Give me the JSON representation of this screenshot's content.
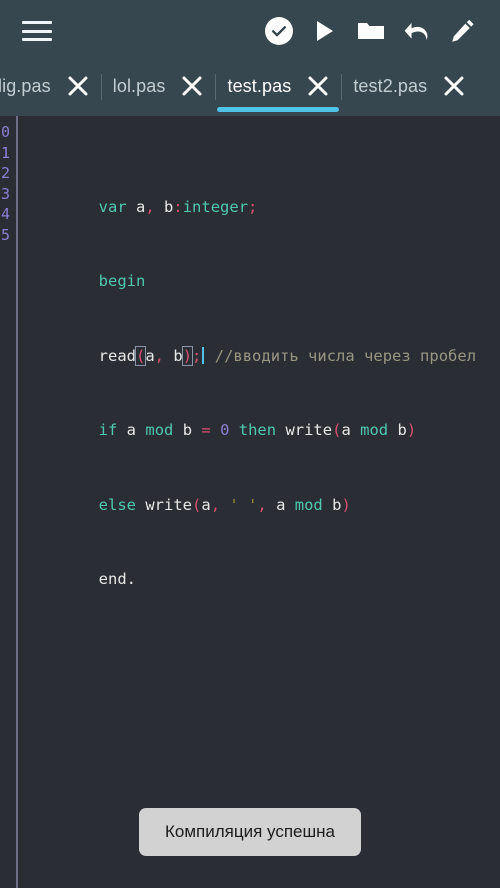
{
  "toolbar": {
    "menu_label": "Menu",
    "buttons": [
      {
        "name": "menu-button",
        "icon": "hamburger-menu-icon",
        "label": "Menu"
      },
      {
        "name": "compile-button",
        "icon": "check-circle-icon",
        "label": "Compile"
      },
      {
        "name": "run-button",
        "icon": "play-icon",
        "label": "Run"
      },
      {
        "name": "open-button",
        "icon": "folder-icon",
        "label": "Open file"
      },
      {
        "name": "undo-button",
        "icon": "undo-icon",
        "label": "Undo"
      },
      {
        "name": "edit-button",
        "icon": "pencil-icon",
        "label": "Edit"
      }
    ]
  },
  "tabs": {
    "close_icon": "close-icon",
    "items": [
      {
        "label": "lig.pas",
        "active": false
      },
      {
        "label": "lol.pas",
        "active": false
      },
      {
        "label": "test.pas",
        "active": true
      },
      {
        "label": "test2.pas",
        "active": false
      }
    ]
  },
  "editor": {
    "line_numbers": [
      "0",
      "1",
      "2",
      "3",
      "4",
      "5"
    ],
    "lines": [
      {
        "n": "0",
        "text": "var a, b:integer;"
      },
      {
        "n": "1",
        "text": "begin"
      },
      {
        "n": "2",
        "text": "read(a, b); //вводить числа через пробел"
      },
      {
        "n": "3",
        "text": "if a mod b = 0 then write(a mod b)"
      },
      {
        "n": "4",
        "text": "else write(a, ' ', a mod b)"
      },
      {
        "n": "5",
        "text": "end."
      }
    ],
    "comment_text": "//вводить числа через пробел",
    "cursor_line": "2",
    "colors": {
      "background": "#2a2d33",
      "keyword": "#4ec9b0",
      "identifier": "#e8e8e8",
      "punctuation": "#d94f70",
      "number": "#8a7fd4",
      "string": "#9a8a3c",
      "comment": "#9a9684",
      "line_number": "#8a7fd4",
      "caret": "#4fc3e8"
    }
  },
  "toast": {
    "message": "Компиляция успешна"
  },
  "theme": {
    "toolbar_bg": "#36474f",
    "accent": "#4fc3e8",
    "toast_bg": "#d2d2d2"
  }
}
